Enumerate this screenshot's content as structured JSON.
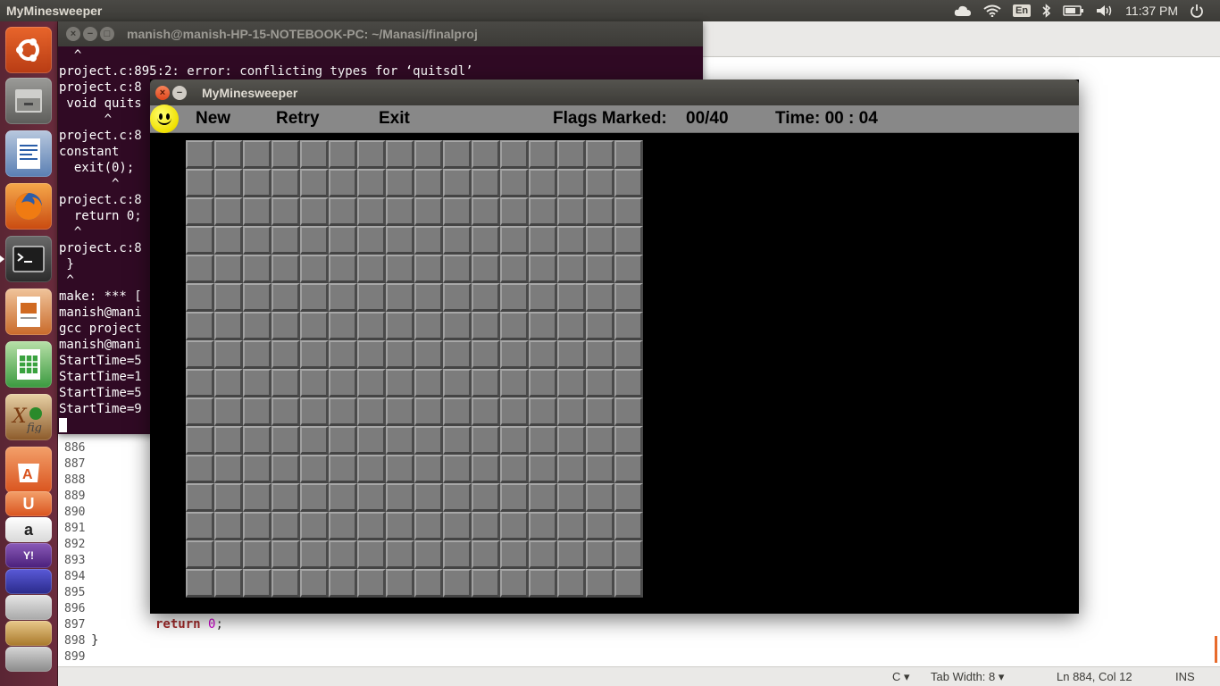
{
  "top_panel": {
    "active_app": "MyMinesweeper",
    "keyboard_layout": "En",
    "clock": "11:37 PM",
    "icons": [
      "cloud-icon",
      "wifi-icon",
      "keyboard-icon",
      "bluetooth-icon",
      "battery-icon",
      "volume-icon",
      "power-icon"
    ]
  },
  "launcher": {
    "items": [
      "ubuntu-dash",
      "files",
      "writer",
      "firefox",
      "terminal",
      "impress",
      "calc",
      "xfig",
      "software-center",
      "ubuntu-one",
      "amazon",
      "yahoo-mail",
      "workspaces",
      "trash"
    ],
    "colors": {
      "firefox": "#e66000",
      "terminal": "#2c2c2c",
      "calc": "#2e9a35",
      "software": "#e05a1f"
    }
  },
  "terminal": {
    "title": "manish@manish-HP-15-NOTEBOOK-PC: ~/Manasi/finalproj",
    "lines": [
      "  ^",
      "project.c:895:2: error: conflicting types for ‘quitsdl’",
      "project.c:8",
      " void quits",
      "      ^",
      "project.c:8",
      "constant",
      "  exit(0);",
      "       ^",
      "project.c:8",
      "  return 0;",
      "  ^",
      "project.c:8",
      " }",
      " ^",
      "make: *** [",
      "manish@mani",
      "gcc project",
      "manish@mani",
      "StartTime=5",
      "StartTime=1",
      "StartTime=5",
      "StartTime=9"
    ]
  },
  "editor": {
    "line_numbers": [
      "886",
      "887",
      "888",
      "889",
      "890",
      "891",
      "892",
      "893",
      "894",
      "895",
      "896",
      "897",
      "898",
      "899"
    ],
    "code_return_kw": "return",
    "code_return_val": "0",
    "code_return_end": ";",
    "code_close_brace": "}",
    "status": {
      "language": "C ▾",
      "tab_width": "Tab Width: 8 ▾",
      "position": "Ln 884, Col 12",
      "mode": "INS"
    }
  },
  "game": {
    "title": "MyMinesweeper",
    "menu": {
      "new": "New",
      "retry": "Retry",
      "exit": "Exit"
    },
    "flags_label": "Flags Marked:",
    "flags_value": "00/40",
    "time_label": "Time: 00 : 04",
    "board": {
      "rows": 16,
      "cols": 16,
      "state": "all-covered"
    }
  }
}
